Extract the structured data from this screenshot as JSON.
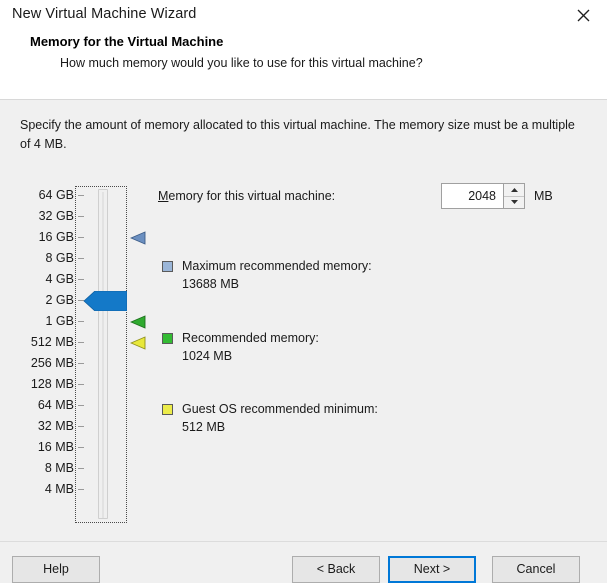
{
  "window": {
    "title": "New Virtual Machine Wizard",
    "close_icon": "close-icon"
  },
  "page": {
    "heading": "Memory for the Virtual Machine",
    "subheading": "How much memory would you like to use for this virtual machine?",
    "instructions": "Specify the amount of memory allocated to this virtual machine. The memory size must be a multiple of 4 MB."
  },
  "memory_field": {
    "label_accel": "M",
    "label_rest": "emory for this virtual machine:",
    "value": "2048",
    "unit": "MB",
    "spin_up_icon": "chevron-up-icon",
    "spin_down_icon": "chevron-down-icon"
  },
  "slider": {
    "ticks": [
      "64 GB",
      "32 GB",
      "16 GB",
      "8 GB",
      "4 GB",
      "2 GB",
      "1 GB",
      "512 MB",
      "256 MB",
      "128 MB",
      "64 MB",
      "32 MB",
      "16 MB",
      "8 MB",
      "4 MB"
    ],
    "thumb_tick_index": 5,
    "thumb_color": "#1479c8",
    "markers": [
      {
        "name": "maximum-recommended-marker",
        "tick_index": 2,
        "color": "#6b8fc0"
      },
      {
        "name": "recommended-marker",
        "tick_index": 6,
        "color": "#2faa2f"
      },
      {
        "name": "guest-os-minimum-marker",
        "tick_index": 7,
        "color": "#e8e83a"
      }
    ]
  },
  "legend": [
    {
      "name": "Maximum recommended memory:",
      "value": "13688 MB",
      "color": "#9bb6d8",
      "icon": "blue-swatch-icon"
    },
    {
      "name": "Recommended memory:",
      "value": "1024 MB",
      "color": "#33bb33",
      "icon": "green-swatch-icon"
    },
    {
      "name": "Guest OS recommended minimum:",
      "value": "512 MB",
      "color": "#ecec4a",
      "icon": "yellow-swatch-icon"
    }
  ],
  "footer": {
    "help": "Help",
    "back": "< Back",
    "next": "Next >",
    "cancel": "Cancel"
  }
}
